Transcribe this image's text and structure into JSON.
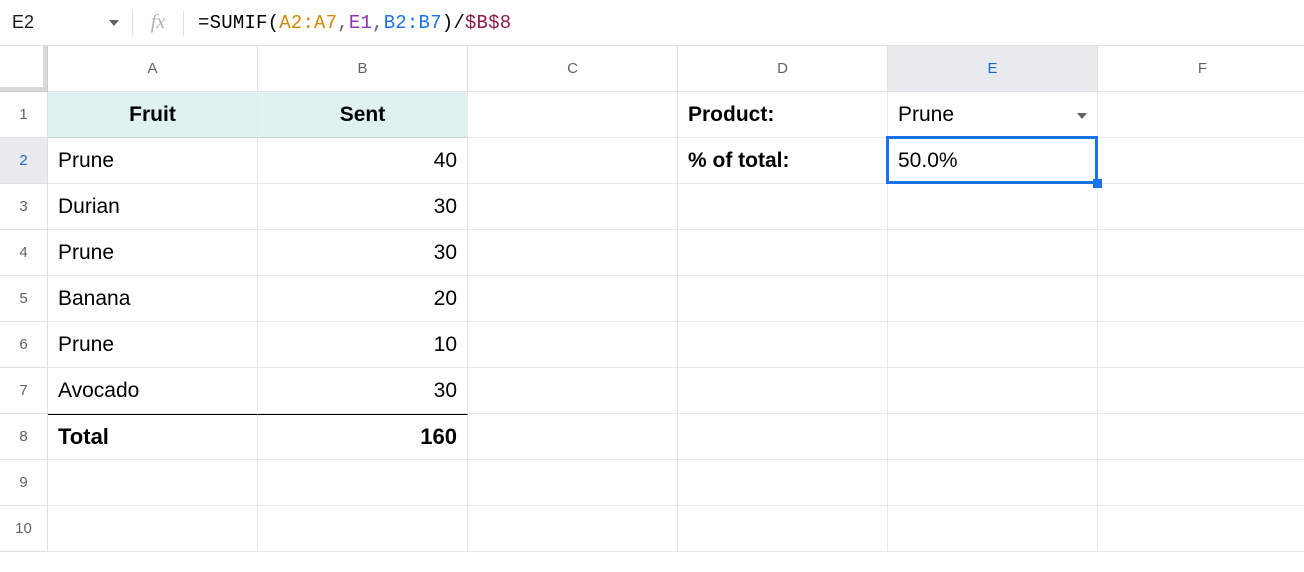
{
  "nameBox": "E2",
  "fxLabel": "fx",
  "formula": {
    "eq": "=",
    "func": "SUMIF",
    "open": "(",
    "r1": "A2:A7",
    "c1": ",",
    "r2": "E1",
    "c2": ",",
    "r3": "B2:B7",
    "close": ")",
    "op": "/",
    "abs": "$B$8"
  },
  "columns": [
    "A",
    "B",
    "C",
    "D",
    "E",
    "F"
  ],
  "rows": [
    "1",
    "2",
    "3",
    "4",
    "5",
    "6",
    "7",
    "8",
    "9",
    "10"
  ],
  "highlightedCol": "E",
  "highlightedRow": "2",
  "headers": {
    "A": "Fruit",
    "B": "Sent"
  },
  "data": {
    "A2": "Prune",
    "B2": "40",
    "A3": "Durian",
    "B3": "30",
    "A4": "Prune",
    "B4": "30",
    "A5": "Banana",
    "B5": "20",
    "A6": "Prune",
    "B6": "10",
    "A7": "Avocado",
    "B7": "30",
    "A8": "Total",
    "B8": "160",
    "D1": "Product:",
    "E1": "Prune",
    "D2": "% of total:",
    "E2": "50.0%"
  },
  "selected": "E2"
}
